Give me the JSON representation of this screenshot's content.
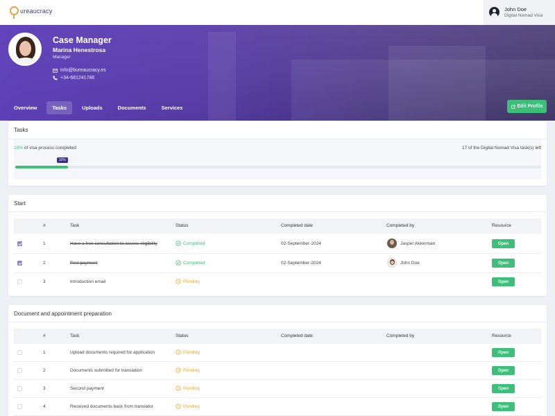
{
  "brand": {
    "logo_text": "ureaucracy"
  },
  "user": {
    "name": "John Doe",
    "subtitle": "Digital Nomad Visa"
  },
  "profile": {
    "title": "Case Manager",
    "name": "Marina Henestrosa",
    "role": "Manager",
    "email": "info@bureaucracy.es",
    "phone": "+34-681241786",
    "edit_label": "Edit Profile"
  },
  "nav": {
    "tabs": [
      {
        "label": "Overview",
        "active": false
      },
      {
        "label": "Tasks",
        "active": true
      },
      {
        "label": "Uploads",
        "active": false
      },
      {
        "label": "Documents",
        "active": false
      },
      {
        "label": "Services",
        "active": false
      }
    ]
  },
  "tasks_card": {
    "title": "Tasks",
    "progress_pct_text": "10%",
    "progress_text": " of visa process completed",
    "progress_value": 0.1,
    "progress_badge": "10%",
    "remaining_text": "17 of the Digital Nomad Visa task(s) left"
  },
  "colors": {
    "accent_green": "#3dbf7a",
    "pending_orange": "#f0a818",
    "hero_purple": "#6040be",
    "badge_navy": "#3b2d86"
  },
  "columns": {
    "num": "#",
    "task": "Task",
    "status": "Status",
    "completed_date": "Completed date",
    "completed_by": "Completed by",
    "resource": "Resource"
  },
  "start_section": {
    "title": "Start",
    "rows": [
      {
        "num": "1",
        "task": "Have a free consultation to assess eligibility",
        "status": "Completed",
        "date": "02-September-2024",
        "by": "Jasper Akkerman",
        "resource": "Open",
        "checked": true
      },
      {
        "num": "2",
        "task": "First payment",
        "status": "Completed",
        "date": "02-September-2024",
        "by": "John Doe",
        "resource": "Open",
        "checked": true
      },
      {
        "num": "3",
        "task": "Introduction email",
        "status": "Pending",
        "date": "",
        "by": "",
        "resource": "Open",
        "checked": false
      }
    ]
  },
  "doc_section": {
    "title": "Document and appointment preparation",
    "rows": [
      {
        "num": "1",
        "task": "Upload documents required for application",
        "status": "Pending",
        "resource": "Open"
      },
      {
        "num": "2",
        "task": "Documents submitted for translation",
        "status": "Pending",
        "resource": "Open"
      },
      {
        "num": "3",
        "task": "Second payment",
        "status": "Pending",
        "resource": "Open"
      },
      {
        "num": "4",
        "task": "Received documents back from translator",
        "status": "Pending",
        "resource": "Open"
      }
    ]
  }
}
